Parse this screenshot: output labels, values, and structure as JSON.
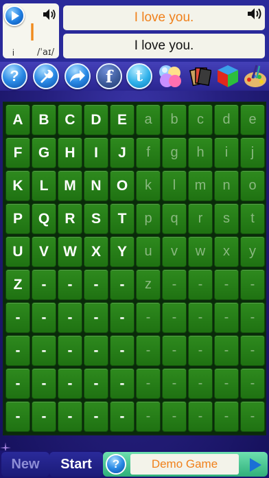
{
  "phonics": {
    "letter": "I",
    "sound": "i",
    "ipa": "/ˈaɪ/"
  },
  "sentences": {
    "top": "I love you.",
    "bottom": "I love you."
  },
  "toolbar": {
    "help_label": "?"
  },
  "grid": {
    "rows": [
      [
        "A",
        "B",
        "C",
        "D",
        "E",
        "a",
        "b",
        "c",
        "d",
        "e"
      ],
      [
        "F",
        "G",
        "H",
        "I",
        "J",
        "f",
        "g",
        "h",
        "i",
        "j"
      ],
      [
        "K",
        "L",
        "M",
        "N",
        "O",
        "k",
        "l",
        "m",
        "n",
        "o"
      ],
      [
        "P",
        "Q",
        "R",
        "S",
        "T",
        "p",
        "q",
        "r",
        "s",
        "t"
      ],
      [
        "U",
        "V",
        "W",
        "X",
        "Y",
        "u",
        "v",
        "w",
        "x",
        "y"
      ],
      [
        "Z",
        "-",
        "-",
        "-",
        "-",
        "z",
        "-",
        "-",
        "-",
        "-"
      ],
      [
        "-",
        "-",
        "-",
        "-",
        "-",
        "-",
        "-",
        "-",
        "-",
        "-"
      ],
      [
        "-",
        "-",
        "-",
        "-",
        "-",
        "-",
        "-",
        "-",
        "-",
        "-"
      ],
      [
        "-",
        "-",
        "-",
        "-",
        "-",
        "-",
        "-",
        "-",
        "-",
        "-"
      ],
      [
        "-",
        "-",
        "-",
        "-",
        "-",
        "-",
        "-",
        "-",
        "-",
        "-"
      ]
    ]
  },
  "bottom_bar": {
    "new_label": "New",
    "start_label": "Start",
    "demo_help_label": "?",
    "demo_label": "Demo Game"
  },
  "colors": {
    "accent_orange": "#f0801a",
    "tile_green": "#2e8a1e",
    "background_blue": "#262080"
  }
}
